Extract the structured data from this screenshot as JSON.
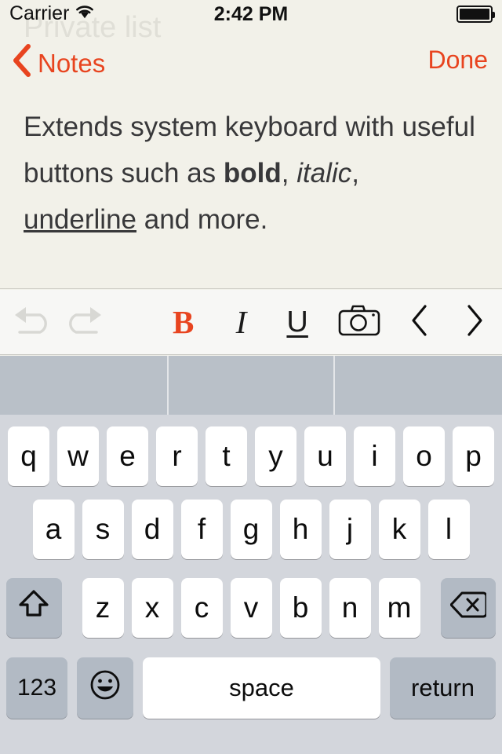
{
  "status_bar": {
    "carrier": "Carrier",
    "wifi_icon": "wifi-icon",
    "time": "2:42 PM",
    "battery_icon": "battery-full-icon"
  },
  "background_title": "Private list",
  "nav_bar": {
    "back_icon": "chevron-left-icon",
    "back_label": "Notes",
    "done_label": "Done",
    "accent_color": "#e8441f"
  },
  "note": {
    "line1": "Extends system keyboard",
    "line2": "with useful buttons such as",
    "bold_word": "bold",
    "comma1": ", ",
    "italic_word": "italic",
    "comma2": ", ",
    "underline_word": "underline",
    "tail": " and",
    "line4": "more.",
    "text_color": "#38383a",
    "paper_color": "#f2f1e9"
  },
  "format_toolbar": {
    "undo_icon": "undo-arrow-icon",
    "redo_icon": "redo-arrow-icon",
    "bold_label": "B",
    "italic_label": "I",
    "underline_label": "U",
    "camera_icon": "camera-icon",
    "prev_icon": "chevron-left-icon",
    "next_icon": "chevron-right-icon",
    "active_color": "#e8441f",
    "disabled_color": "#d6d6d2"
  },
  "predictive_bar": {
    "suggestions": [
      "",
      "",
      ""
    ],
    "background_color": "#b9c0c8"
  },
  "keyboard": {
    "background_color": "#d3d6dc",
    "row1": [
      "q",
      "w",
      "e",
      "r",
      "t",
      "y",
      "u",
      "i",
      "o",
      "p"
    ],
    "row2": [
      "a",
      "s",
      "d",
      "f",
      "g",
      "h",
      "j",
      "k",
      "l"
    ],
    "row3": [
      "z",
      "x",
      "c",
      "v",
      "b",
      "n",
      "m"
    ],
    "shift_icon": "shift-arrow-icon",
    "backspace_icon": "backspace-delete-icon",
    "numeric_label": "123",
    "emoji_icon": "smiley-face-icon",
    "space_label": "space",
    "return_label": "return"
  }
}
